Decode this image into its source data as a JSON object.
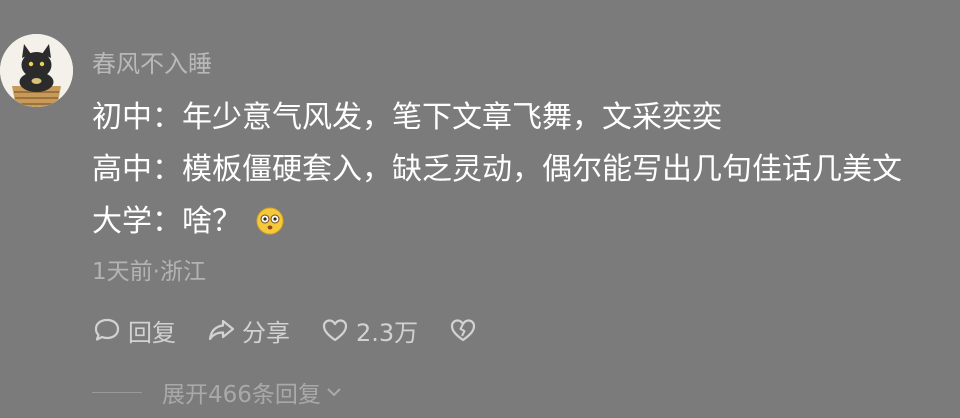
{
  "comment": {
    "username": "春风不入睡",
    "lines": [
      "初中：年少意气风发，笔下文章飞舞，文采奕奕",
      "高中：模板僵硬套入，缺乏灵动，偶尔能写出几句佳话几美文",
      "大学：啥？"
    ],
    "emoji_icon": "flushed-face-icon",
    "meta": "1天前·浙江",
    "actions": {
      "reply_label": "回复",
      "share_label": "分享",
      "like_count": "2.3万"
    },
    "expand_label": "展开466条回复"
  },
  "colors": {
    "background": "#7b7b7b",
    "username": "#b9b9b9",
    "content_text": "#ffffff",
    "meta_text": "#b3b3b3"
  }
}
